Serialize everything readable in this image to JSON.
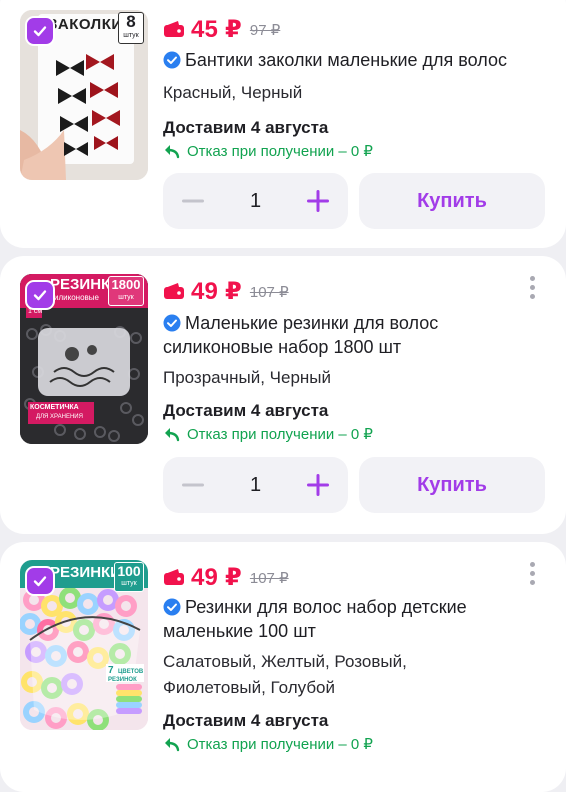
{
  "items": [
    {
      "image_caption": "ЗАКОЛКИ",
      "image_badge_number": "8",
      "image_badge_unit": "штук",
      "price": "45 ₽",
      "old_price": "97 ₽",
      "title": "Бантики заколки маленькие для волос",
      "variant": "Красный, Черный",
      "delivery": "Доставим 4 августа",
      "refund": "Отказ при получении – 0 ₽",
      "quantity": "1",
      "buy_label": "Купить"
    },
    {
      "image_caption": "РЕЗИНКИ",
      "image_subcaption": "силиконовые",
      "image_badge_number": "1800",
      "image_badge_unit": "штук",
      "image_size_label": "1 см",
      "image_bottom_label": "КОСМЕТИЧКА",
      "image_bottom_sublabel": "ДЛЯ ХРАНЕНИЯ",
      "price": "49 ₽",
      "old_price": "107 ₽",
      "title": "Маленькие резинки для волос силиконовые набор 1800 шт",
      "variant": "Прозрачный, Черный",
      "delivery": "Доставим 4 августа",
      "refund": "Отказ при получении – 0 ₽",
      "quantity": "1",
      "buy_label": "Купить"
    },
    {
      "image_caption": "РЕЗИНКИ",
      "image_badge_number": "100",
      "image_badge_unit": "штук",
      "image_colors_number": "7",
      "image_colors_label": "ЦВЕТОВ",
      "image_colors_sublabel": "РЕЗИНОК",
      "price": "49 ₽",
      "old_price": "107 ₽",
      "title": "Резинки для волос набор детские маленькие 100 шт",
      "variant": "Салатовый, Желтый, Розовый, Фиолетовый, Голубой",
      "delivery": "Доставим 4 августа",
      "refund": "Отказ при получении – 0 ₽"
    }
  ],
  "colors": {
    "price": "#f1124c",
    "accent": "#a23ce8",
    "refund": "#12a350",
    "verified": "#2a7ff0"
  },
  "icons": [
    "checkbox-checked-icon",
    "wallet-icon",
    "verified-icon",
    "return-arrow-icon",
    "minus-icon",
    "plus-icon",
    "more-vertical-icon"
  ]
}
